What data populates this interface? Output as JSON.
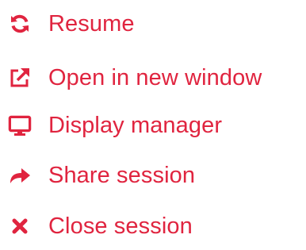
{
  "colors": {
    "accent": "#e0243f"
  },
  "menu": {
    "items": [
      {
        "label": "Resume",
        "icon": "refresh-icon"
      },
      {
        "label": "Open in new window",
        "icon": "external-link-icon"
      },
      {
        "label": "Display manager",
        "icon": "monitor-icon"
      },
      {
        "label": "Share session",
        "icon": "share-arrow-icon"
      },
      {
        "label": "Close session",
        "icon": "close-icon"
      }
    ]
  }
}
